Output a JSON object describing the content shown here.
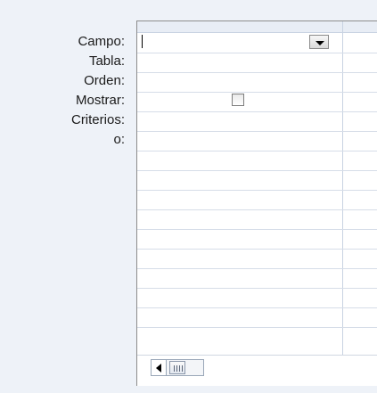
{
  "row_labels": [
    "Campo:",
    "Tabla:",
    "Orden:",
    "Mostrar:",
    "Criterios:",
    "o:"
  ],
  "field": {
    "value": ""
  },
  "show_checkbox": {
    "checked": false
  }
}
